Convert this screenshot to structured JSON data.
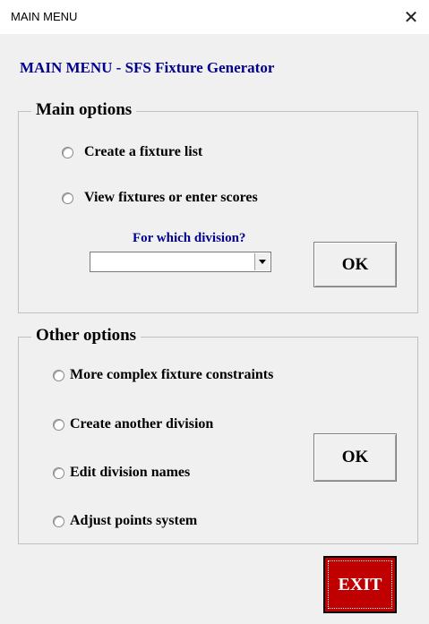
{
  "window": {
    "title": "MAIN MENU",
    "close_glyph": "✕"
  },
  "heading": "MAIN MENU - SFS Fixture Generator",
  "main_options": {
    "label": "Main options",
    "items": [
      "Create a fixture list",
      "View fixtures or enter scores"
    ],
    "division_prompt": "For which division?",
    "division_value": "",
    "ok_label": "OK"
  },
  "other_options": {
    "label": "Other options",
    "items": [
      "More complex fixture constraints",
      "Create another division",
      "Edit division names",
      "Adjust points system"
    ],
    "ok_label": "OK"
  },
  "exit_label": "EXIT",
  "colors": {
    "heading": "#00008b",
    "exit_bg": "#c00000",
    "exit_text": "#ffffff"
  }
}
